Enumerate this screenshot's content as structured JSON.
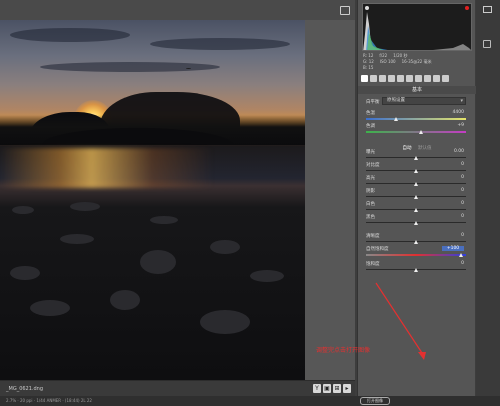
{
  "canvas": {
    "filename": "_MG_0621.dng"
  },
  "bottombar": {
    "buttons": [
      "Y",
      "▣",
      "⊞",
      "▸"
    ]
  },
  "footer": {
    "text": "2.7% · 20 ppi · 1/44 ANMER · (18:44) 2L 22",
    "button_label": "打开图像"
  },
  "camera_info": {
    "row1": [
      "R: 12",
      "f/22",
      "1/20 秒"
    ],
    "row2": [
      "G: 12",
      "ISO 100",
      "16-35@22 毫米"
    ],
    "row3": [
      "B: 15"
    ]
  },
  "panel": {
    "title": "基本",
    "white_balance_label": "白平衡",
    "white_balance_value": "原照设置",
    "auto_label": "自动",
    "default_label": "默认值",
    "sliders": [
      {
        "label": "色温",
        "value": "4400",
        "level": 0.3,
        "track": "temp",
        "highlight": false
      },
      {
        "label": "色调",
        "value": "+9",
        "level": 0.55,
        "track": "tint",
        "highlight": false
      },
      {
        "label": "曝光",
        "value": "0.00",
        "level": 0.5,
        "track": "plain",
        "highlight": false
      },
      {
        "label": "对比度",
        "value": "0",
        "level": 0.5,
        "track": "plain",
        "highlight": false
      },
      {
        "label": "高光",
        "value": "0",
        "level": 0.5,
        "track": "plain",
        "highlight": false
      },
      {
        "label": "阴影",
        "value": "0",
        "level": 0.5,
        "track": "plain",
        "highlight": false
      },
      {
        "label": "白色",
        "value": "0",
        "level": 0.5,
        "track": "plain",
        "highlight": false
      },
      {
        "label": "黑色",
        "value": "0",
        "level": 0.5,
        "track": "plain",
        "highlight": false
      },
      {
        "label": "清晰度",
        "value": "0",
        "level": 0.5,
        "track": "plain",
        "highlight": false
      },
      {
        "label": "自然饱和度",
        "value": "+100",
        "level": 0.95,
        "track": "sat",
        "highlight": true
      },
      {
        "label": "饱和度",
        "value": "0",
        "level": 0.5,
        "track": "plain",
        "highlight": false
      }
    ]
  },
  "annotation": {
    "text": "调整完点击打开图像"
  },
  "colors": {
    "annotation": "#e53030",
    "highlight": "#4a6fbf"
  },
  "icons": [
    "expand-icon",
    "histogram-shadow-clip-icon",
    "histogram-highlight-clip-icon",
    "panel-toggle-icon"
  ]
}
